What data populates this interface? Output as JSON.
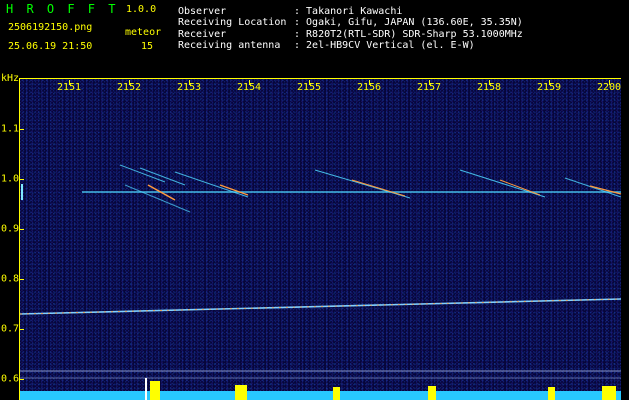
{
  "header": {
    "app_name": "H R O F F T",
    "version": "1.0.0",
    "filename": "2506192150.png",
    "meteor_label": "meteor",
    "datetime": "25.06.19 21:50",
    "meteor_count": "15",
    "observer_label": "Observer",
    "observer_value": ": Takanori Kawachi",
    "location_label": "Receiving Location",
    "location_value": ": Ogaki, Gifu, JAPAN (136.60E, 35.35N)",
    "receiver_label": "Receiver",
    "receiver_value": ": R820T2(RTL-SDR) SDR-Sharp 53.1000MHz",
    "antenna_label": "Receiving antenna",
    "antenna_value": ": 2el-HB9CV Vertical (el. E-W)"
  },
  "axes": {
    "y_unit": "kHz",
    "x_ticks": [
      "2151",
      "2152",
      "2153",
      "2154",
      "2155",
      "2156",
      "2157",
      "2158",
      "2159",
      "2200"
    ],
    "y_ticks": [
      "1.1",
      "1.0",
      "0.9",
      "0.8",
      "0.7",
      "0.6"
    ]
  },
  "colors": {
    "background": "#000000",
    "spectrogram_bg": "#06063a",
    "axis": "#ffff00",
    "title_green": "#00ff00",
    "signal_cyan": "#4fd8ff",
    "signal_warm": "#ff9a3c"
  }
}
